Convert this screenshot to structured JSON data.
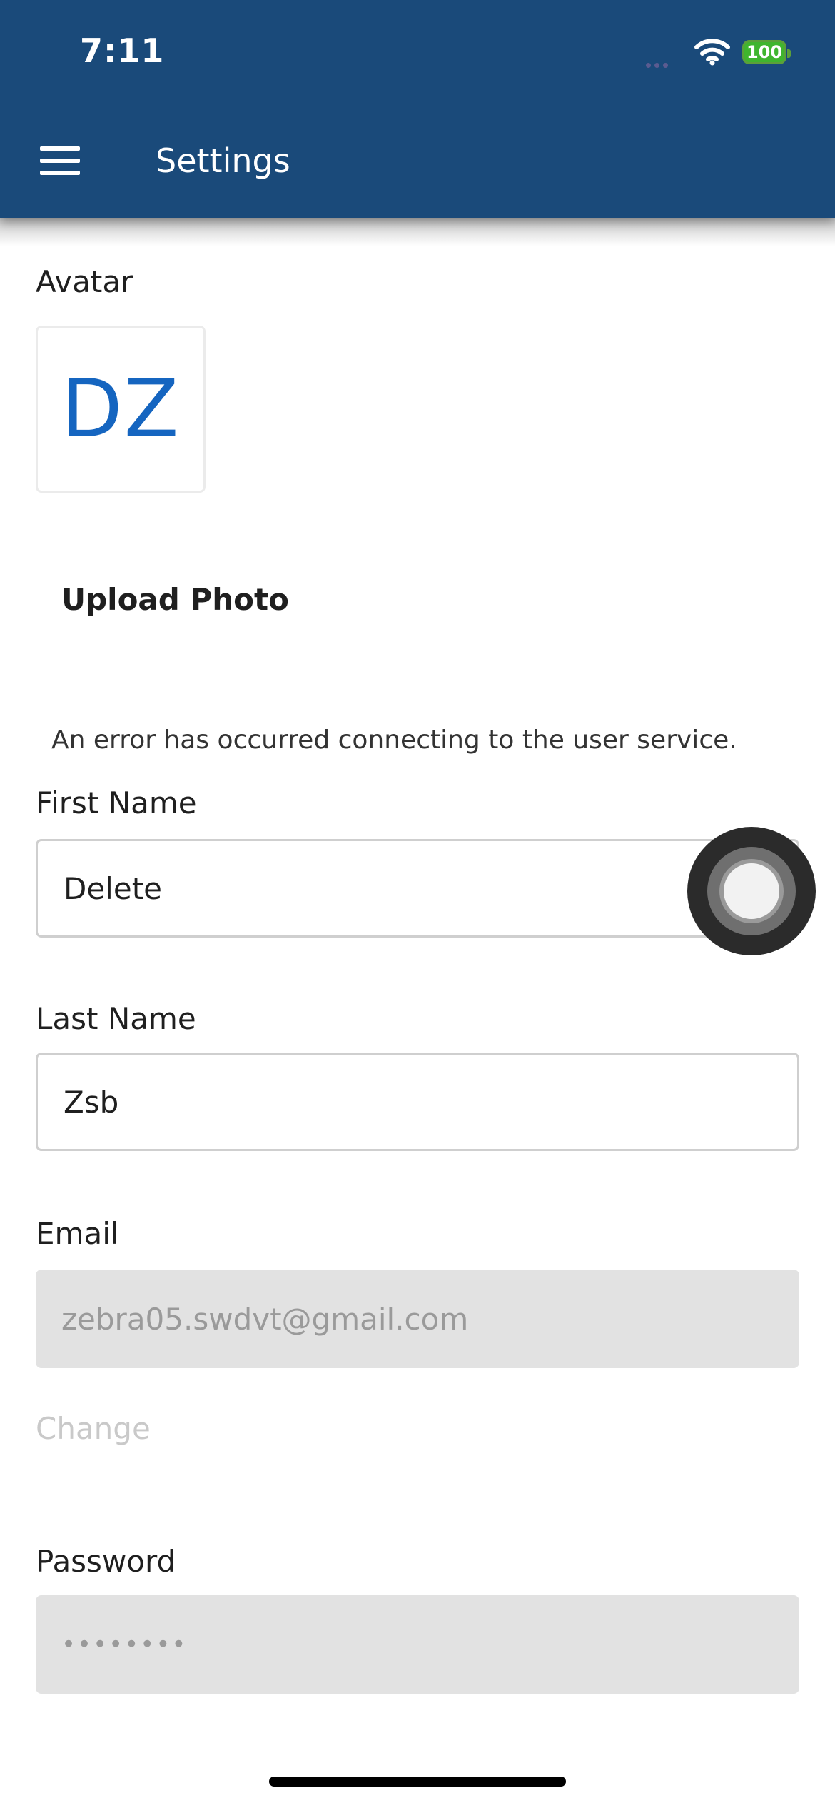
{
  "status_bar": {
    "time": "7:11",
    "battery_level": "100"
  },
  "app_bar": {
    "title": "Settings",
    "menu_icon": "hamburger-menu-icon",
    "background_color": "#1a4a7a"
  },
  "avatar": {
    "label": "Avatar",
    "initials": "DZ",
    "initials_color": "#1565c0",
    "upload_label": "Upload Photo"
  },
  "error_message": "An error has occurred connecting to the user service.",
  "first_name": {
    "label": "First Name",
    "value": "Delete"
  },
  "last_name": {
    "label": "Last Name",
    "value": "Zsb"
  },
  "email": {
    "label": "Email",
    "value": "zebra05.swdvt@gmail.com",
    "change_label": "Change"
  },
  "password": {
    "label": "Password",
    "value": "••••••••"
  }
}
